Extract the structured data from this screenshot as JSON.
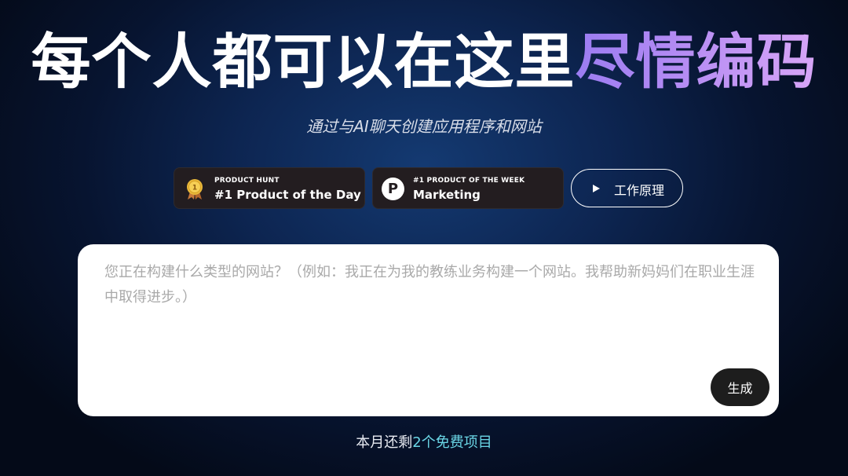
{
  "hero": {
    "title_plain": "每个人都可以在这里",
    "title_accent": "尽情编码",
    "subtitle": "通过与AI聊天创建应用程序和网站"
  },
  "badges": {
    "product_hunt": {
      "small": "PRODUCT HUNT",
      "big": "#1 Product of the Day",
      "icon": "gold-medal-icon",
      "medal_number": "1"
    },
    "product_week": {
      "small": "#1 PRODUCT OF THE WEEK",
      "big": "Marketing",
      "icon": "product-hunt-p-icon",
      "logo_letter": "P"
    }
  },
  "how_it_works": {
    "label": "工作原理",
    "icon": "play-icon"
  },
  "prompt": {
    "placeholder": "您正在构建什么类型的网站？（例如：我正在为我的教练业务构建一个网站。我帮助新妈妈们在职业生涯中取得进步。）",
    "value": "",
    "generate_label": "生成"
  },
  "quota": {
    "prefix": "本月还剩",
    "highlight": "2个免费项目"
  },
  "colors": {
    "accent_gradient_start": "#9b7cf2",
    "accent_gradient_end": "#d8a6f7",
    "badge_bg": "#231d20",
    "quota_highlight": "#6ad6e6",
    "generate_button_bg": "#1d1d1d"
  }
}
